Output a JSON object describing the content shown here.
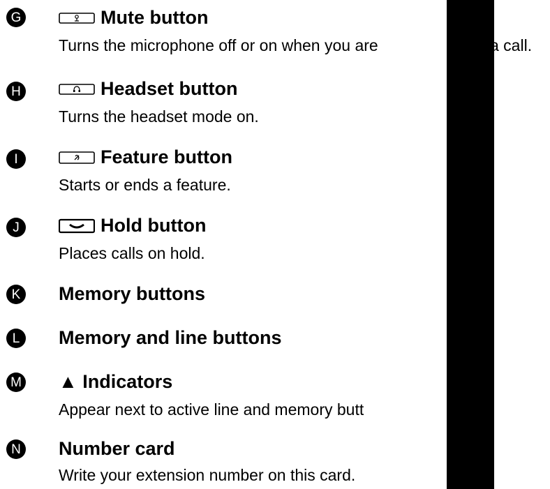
{
  "items": [
    {
      "letter": "G",
      "title": "Mute button",
      "icon": "mute-key-icon",
      "desc": "Turns the microphone off or on when you are"
    },
    {
      "letter": "H",
      "title": "Headset button",
      "icon": "headset-key-icon",
      "desc": "Turns the headset mode on."
    },
    {
      "letter": "I",
      "title": "Feature button",
      "icon": "feature-key-icon",
      "desc": "Starts or ends a feature."
    },
    {
      "letter": "J",
      "title": "Hold button",
      "icon": "hold-key-icon",
      "desc": "Places calls on hold."
    },
    {
      "letter": "K",
      "title": "Memory buttons"
    },
    {
      "letter": "L",
      "title": "Memory and line buttons"
    },
    {
      "letter": "M",
      "title": "▲ Indicators",
      "desc": "Appear next to active line and memory butt"
    },
    {
      "letter": "N",
      "title": "Number card",
      "desc": "Write your extension number on this card."
    }
  ],
  "overflow_text": {
    "g_line_tail": "a call."
  },
  "redaction_color": "#000000"
}
